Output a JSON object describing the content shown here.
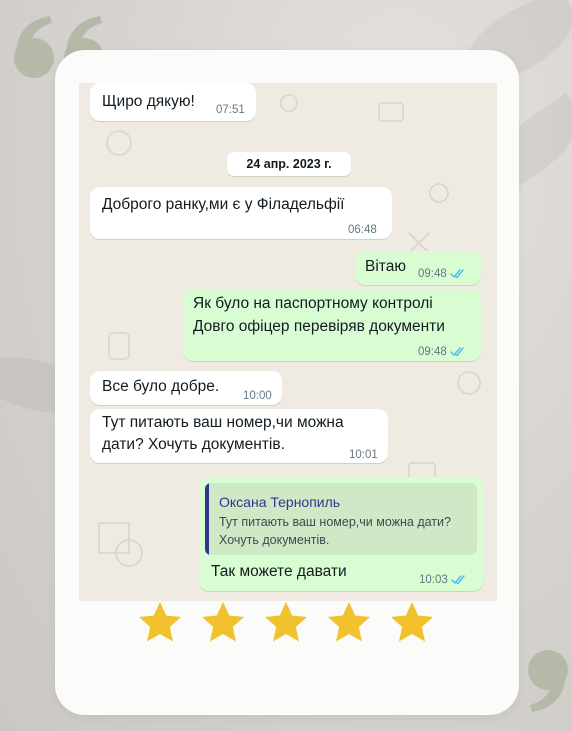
{
  "colors": {
    "incoming_bubble": "#ffffff",
    "outgoing_bubble": "#d9fdd3",
    "read_ticks": "#53bdeb",
    "reply_accent": "#35338f",
    "star": "#f2c12e",
    "quote_marks": "#b5baa8"
  },
  "decor": {
    "quote_open": "quote-open-icon",
    "quote_close": "quote-close-icon",
    "star": "star-icon",
    "read_receipt": "double-check-icon"
  },
  "chat": {
    "date_separator": "24 апр. 2023 г.",
    "messages": [
      {
        "direction": "in",
        "text": "Щиро дякую!",
        "time": "07:51"
      },
      {
        "direction": "in",
        "text": "Доброго ранку,ми є у Філадельфії",
        "time": "06:48"
      },
      {
        "direction": "out",
        "text": "Вітаю",
        "time": "09:48"
      },
      {
        "direction": "out",
        "lines": [
          "Як було на паспортному контролі",
          "Довго офіцер перевіряв документи"
        ],
        "time": "09:48"
      },
      {
        "direction": "in",
        "text": "Все було добре.",
        "time": "10:00"
      },
      {
        "direction": "in",
        "lines": [
          "Тут питають ваш номер,чи можна",
          "дати? Хочуть документів."
        ],
        "time": "10:01"
      },
      {
        "direction": "out",
        "reply": {
          "author": "Оксана Тернопиль",
          "lines": [
            "Тут питають ваш номер,чи можна дати?",
            "Хочуть документів."
          ]
        },
        "text": "Так можете давати",
        "time": "10:03"
      }
    ]
  },
  "rating": {
    "stars": 5,
    "max": 5
  }
}
